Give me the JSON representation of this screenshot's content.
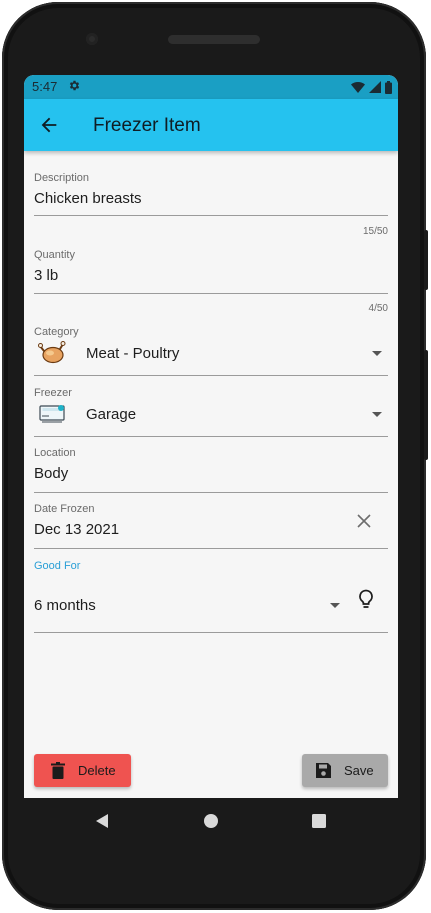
{
  "status_bar": {
    "time": "5:47"
  },
  "app_bar": {
    "title": "Freezer Item"
  },
  "description": {
    "label": "Description",
    "value": "Chicken breasts",
    "counter": "15/50"
  },
  "quantity": {
    "label": "Quantity",
    "value": "3 lb",
    "counter": "4/50"
  },
  "category": {
    "label": "Category",
    "value": "Meat - Poultry",
    "icon": "poultry-icon"
  },
  "freezer": {
    "label": "Freezer",
    "value": "Garage",
    "icon": "freezer-icon"
  },
  "location": {
    "label": "Location",
    "value": "Body"
  },
  "date_frozen": {
    "label": "Date Frozen",
    "value": "Dec 13 2021"
  },
  "good_for": {
    "label": "Good For",
    "value": "6 months"
  },
  "buttons": {
    "delete": "Delete",
    "save": "Save"
  },
  "colors": {
    "status_bar": "#1a9fc4",
    "app_bar": "#25c2ef",
    "focus_label": "#2a9fd6",
    "delete": "#ef5350",
    "save": "#a9a9a9"
  }
}
